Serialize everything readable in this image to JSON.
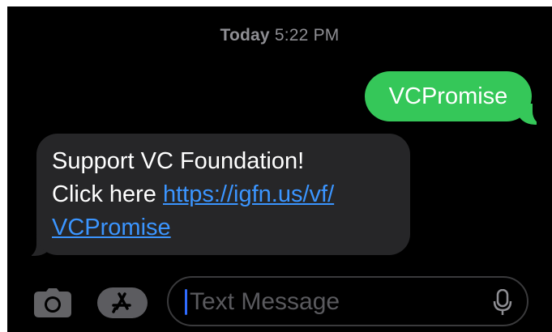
{
  "thread": {
    "timestamp_day": "Today",
    "timestamp_time": "5:22 PM"
  },
  "messages": [
    {
      "direction": "outgoing",
      "text": "VCPromise"
    },
    {
      "direction": "incoming",
      "line1": "Support VC Foundation!",
      "prefix": "Click here ",
      "link_part1": "https://igfn.us/vf/",
      "link_part2": "VCPromise"
    }
  ],
  "composer": {
    "placeholder": "Text Message"
  },
  "colors": {
    "outgoing_bubble": "#35c759",
    "incoming_bubble": "#262628",
    "link": "#3b95ff",
    "background": "#000000"
  },
  "icons": [
    "camera-icon",
    "app-store-icon",
    "microphone-icon"
  ]
}
